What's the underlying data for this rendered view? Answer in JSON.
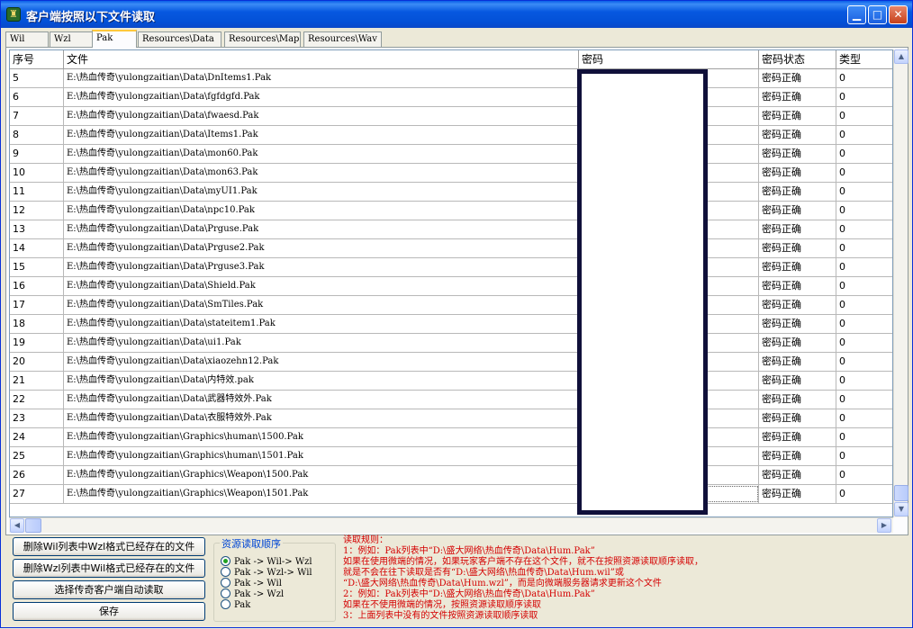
{
  "window": {
    "title": "客户端按照以下文件读取",
    "icon": "app-icon",
    "buttons": {
      "minimize": "minimize-icon",
      "maximize": "maximize-icon",
      "close": "close-icon"
    }
  },
  "tabs": [
    {
      "label": "Wil",
      "active": false
    },
    {
      "label": "Wzl",
      "active": false
    },
    {
      "label": "Pak",
      "active": true
    },
    {
      "label": "Resources\\Data",
      "active": false
    },
    {
      "label": "Resources\\Map",
      "active": false
    },
    {
      "label": "Resources\\Wav",
      "active": false
    }
  ],
  "table": {
    "columns": [
      "序号",
      "文件",
      "密码",
      "密码状态",
      "类型"
    ],
    "rows": [
      {
        "no": "5",
        "file": "E:\\热血传奇\\yulongzaitian\\Data\\DnItems1.Pak",
        "status": "密码正确",
        "type": "0"
      },
      {
        "no": "6",
        "file": "E:\\热血传奇\\yulongzaitian\\Data\\fgfdgfd.Pak",
        "status": "密码正确",
        "type": "0"
      },
      {
        "no": "7",
        "file": "E:\\热血传奇\\yulongzaitian\\Data\\fwaesd.Pak",
        "status": "密码正确",
        "type": "0"
      },
      {
        "no": "8",
        "file": "E:\\热血传奇\\yulongzaitian\\Data\\Items1.Pak",
        "status": "密码正确",
        "type": "0"
      },
      {
        "no": "9",
        "file": "E:\\热血传奇\\yulongzaitian\\Data\\mon60.Pak",
        "status": "密码正确",
        "type": "0"
      },
      {
        "no": "10",
        "file": "E:\\热血传奇\\yulongzaitian\\Data\\mon63.Pak",
        "status": "密码正确",
        "type": "0"
      },
      {
        "no": "11",
        "file": "E:\\热血传奇\\yulongzaitian\\Data\\myUI1.Pak",
        "status": "密码正确",
        "type": "0"
      },
      {
        "no": "12",
        "file": "E:\\热血传奇\\yulongzaitian\\Data\\npc10.Pak",
        "status": "密码正确",
        "type": "0"
      },
      {
        "no": "13",
        "file": "E:\\热血传奇\\yulongzaitian\\Data\\Prguse.Pak",
        "status": "密码正确",
        "type": "0"
      },
      {
        "no": "14",
        "file": "E:\\热血传奇\\yulongzaitian\\Data\\Prguse2.Pak",
        "status": "密码正确",
        "type": "0"
      },
      {
        "no": "15",
        "file": "E:\\热血传奇\\yulongzaitian\\Data\\Prguse3.Pak",
        "status": "密码正确",
        "type": "0"
      },
      {
        "no": "16",
        "file": "E:\\热血传奇\\yulongzaitian\\Data\\Shield.Pak",
        "status": "密码正确",
        "type": "0"
      },
      {
        "no": "17",
        "file": "E:\\热血传奇\\yulongzaitian\\Data\\SmTiles.Pak",
        "status": "密码正确",
        "type": "0"
      },
      {
        "no": "18",
        "file": "E:\\热血传奇\\yulongzaitian\\Data\\stateitem1.Pak",
        "status": "密码正确",
        "type": "0"
      },
      {
        "no": "19",
        "file": "E:\\热血传奇\\yulongzaitian\\Data\\ui1.Pak",
        "status": "密码正确",
        "type": "0"
      },
      {
        "no": "20",
        "file": "E:\\热血传奇\\yulongzaitian\\Data\\xiaozehn12.Pak",
        "status": "密码正确",
        "type": "0"
      },
      {
        "no": "21",
        "file": "E:\\热血传奇\\yulongzaitian\\Data\\内特效.pak",
        "status": "密码正确",
        "type": "0"
      },
      {
        "no": "22",
        "file": "E:\\热血传奇\\yulongzaitian\\Data\\武器特效外.Pak",
        "status": "密码正确",
        "type": "0"
      },
      {
        "no": "23",
        "file": "E:\\热血传奇\\yulongzaitian\\Data\\衣服特效外.Pak",
        "status": "密码正确",
        "type": "0"
      },
      {
        "no": "24",
        "file": "E:\\热血传奇\\yulongzaitian\\Graphics\\human\\1500.Pak",
        "status": "密码正确",
        "type": "0"
      },
      {
        "no": "25",
        "file": "E:\\热血传奇\\yulongzaitian\\Graphics\\human\\1501.Pak",
        "status": "密码正确",
        "type": "0"
      },
      {
        "no": "26",
        "file": "E:\\热血传奇\\yulongzaitian\\Graphics\\Weapon\\1500.Pak",
        "status": "密码正确",
        "type": "0"
      },
      {
        "no": "27",
        "file": "E:\\热血传奇\\yulongzaitian\\Graphics\\Weapon\\1501.Pak",
        "status": "密码正确",
        "type": "0"
      }
    ]
  },
  "buttons": {
    "delete_wil": "删除Wil列表中Wzl格式已经存在的文件",
    "delete_wzl": "删除Wzl列表中Wil格式已经存在的文件",
    "auto_read": "选择传奇客户端自动读取",
    "save": "保存"
  },
  "resource_order": {
    "title": "资源读取顺序",
    "options": [
      {
        "label": "Pak -> Wil-> Wzl",
        "checked": true
      },
      {
        "label": "Pak -> Wzl-> Wil",
        "checked": false
      },
      {
        "label": "Pak -> Wil",
        "checked": false
      },
      {
        "label": "Pak -> Wzl",
        "checked": false
      },
      {
        "label": "Pak",
        "checked": false
      }
    ]
  },
  "rules": {
    "title": "读取规则：",
    "lines": [
      "1：例如：Pak列表中“D:\\盛大网络\\热血传奇\\Data\\Hum.Pak”",
      "   如果在使用微端的情况，如果玩家客户端不存在这个文件，就不在按照资源读取顺序读取，",
      "   就是不会在往下读取是否有“D:\\盛大网络\\热血传奇\\Data\\Hum.wil”或",
      "   “D:\\盛大网络\\热血传奇\\Data\\Hum.wzl”，而是向微端服务器请求更新这个文件",
      "2：例如：Pak列表中“D:\\盛大网络\\热血传奇\\Data\\Hum.Pak”",
      "   如果在不使用微端的情况，按照资源读取顺序读取",
      "3：上面列表中没有的文件按照资源读取顺序读取"
    ]
  },
  "colors": {
    "titlebar": "#0758e0",
    "rules_text": "#d40000",
    "group_title": "#0046d5"
  }
}
